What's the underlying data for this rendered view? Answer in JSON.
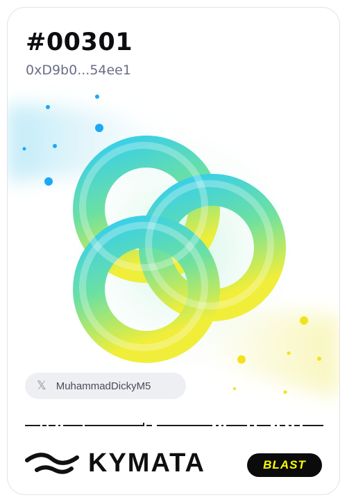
{
  "card": {
    "token_id": "#00301",
    "address": "0xD9b0...54ee1",
    "owner": {
      "platform_icon": "x-logo-icon",
      "glyph": "𝕏",
      "handle": "MuhammadDickyM5"
    },
    "brand": {
      "logo_icon": "kymata-wave-icon",
      "name": "KYMATA"
    },
    "partner_badge": {
      "label": "BLAST",
      "text_color": "#fcfc03",
      "background": "#0b0b0b"
    }
  },
  "colors": {
    "knot_top": "#38d3e6",
    "knot_mid": "#5fe0a8",
    "knot_bottom": "#e6ee3a",
    "blue_dot": "#1ea7f5",
    "yellow_dot": "#f2e21a"
  }
}
